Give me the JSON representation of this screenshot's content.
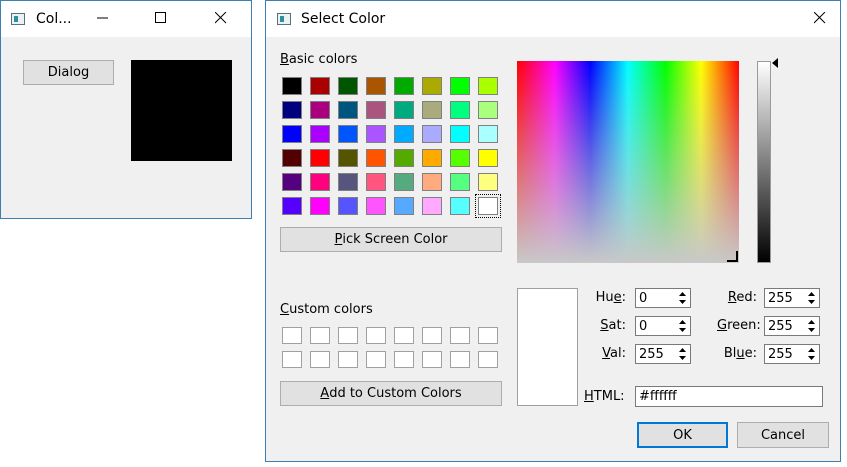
{
  "main_window": {
    "title": "Col...",
    "dialog_button": "Dialog",
    "preview_color": "#000000"
  },
  "dialog": {
    "title": "Select Color",
    "basic_colors_label_key": "B",
    "basic_colors_label_rest": "asic colors",
    "basic_colors": [
      [
        "#000000",
        "#aa0000",
        "#005500",
        "#aa5500",
        "#00aa00",
        "#aaaa00",
        "#00ff00",
        "#aaff00"
      ],
      [
        "#00007f",
        "#aa007f",
        "#00557f",
        "#aa557f",
        "#00aa7f",
        "#aaaa7f",
        "#00ff7f",
        "#aaff7f"
      ],
      [
        "#0000ff",
        "#aa00ff",
        "#0055ff",
        "#aa55ff",
        "#00aaff",
        "#aaaaff",
        "#00ffff",
        "#aaffff"
      ],
      [
        "#550000",
        "#ff0000",
        "#555500",
        "#ff5500",
        "#55aa00",
        "#ffaa00",
        "#55ff00",
        "#ffff00"
      ],
      [
        "#55007f",
        "#ff007f",
        "#55557f",
        "#ff557f",
        "#55aa7f",
        "#ffaa7f",
        "#55ff7f",
        "#ffff7f"
      ],
      [
        "#5500ff",
        "#ff00ff",
        "#5555ff",
        "#ff55ff",
        "#55aaff",
        "#ffaaff",
        "#55ffff",
        "#ffffff"
      ]
    ],
    "pick_screen_key": "P",
    "pick_screen_rest": "ick Screen Color",
    "custom_colors_key": "C",
    "custom_colors_rest": "ustom colors",
    "add_custom_key": "A",
    "add_custom_rest": "dd to Custom Colors",
    "current_color": "#ffffff",
    "hue": {
      "key": "e",
      "pre": "Hu",
      "post": ":",
      "value": "0"
    },
    "sat": {
      "key": "S",
      "pre": "",
      "post": "at:",
      "value": "0"
    },
    "val": {
      "key": "V",
      "pre": "",
      "post": "al:",
      "value": "255"
    },
    "red": {
      "key": "R",
      "pre": "",
      "post": "ed:",
      "value": "255"
    },
    "green": {
      "key": "G",
      "pre": "",
      "post": "reen:",
      "value": "255"
    },
    "blue": {
      "key": "u",
      "pre": "Bl",
      "post": "e:",
      "value": "255"
    },
    "html_key": "H",
    "html_rest": "TML:",
    "html_value": "#ffffff",
    "ok_label": "OK",
    "cancel_label": "Cancel"
  },
  "icons": {
    "minimize": "minimize-icon",
    "maximize": "maximize-icon",
    "close": "close-icon"
  }
}
